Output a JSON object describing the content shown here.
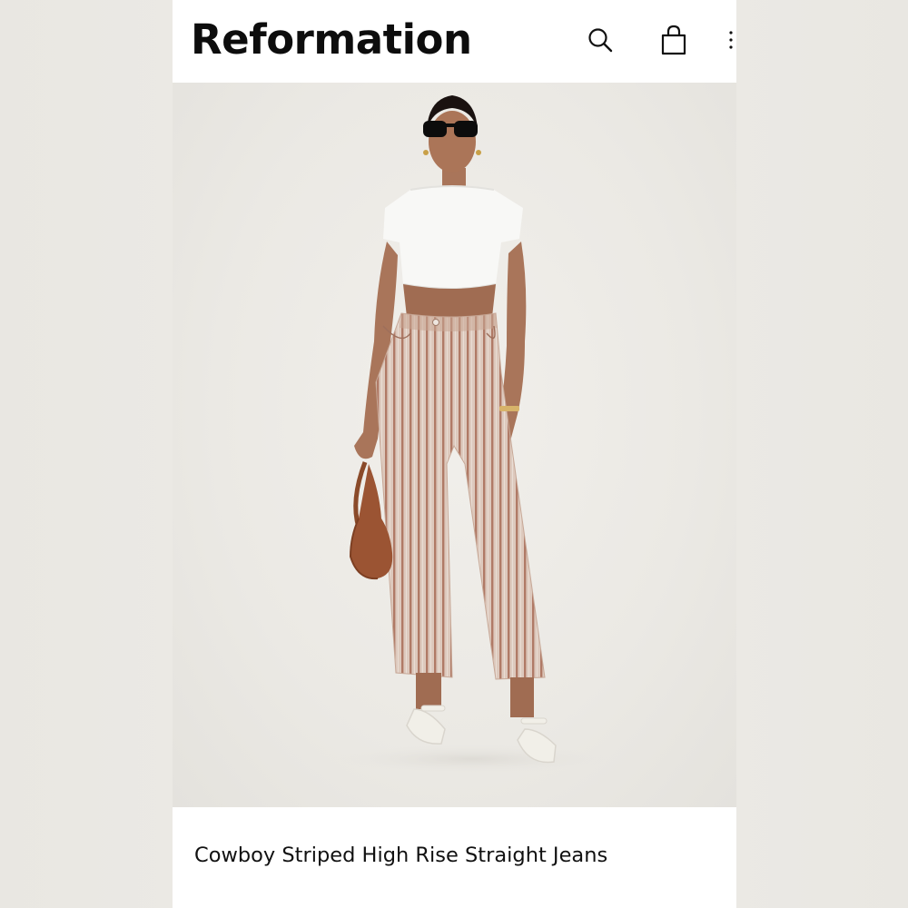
{
  "brand": {
    "name": "Reformation"
  },
  "header": {
    "icons": [
      "search-icon",
      "shopping-bag-icon",
      "more-vertical-icon"
    ]
  },
  "product": {
    "title": "Cowboy Striped High Rise Straight Jeans",
    "image_description_icon": "product-photo"
  },
  "colors": {
    "background": "#ffffff",
    "text": "#0d0d0d",
    "photo_backdrop": "#ebe9e4",
    "jeans_stripe": "#b07a66"
  }
}
